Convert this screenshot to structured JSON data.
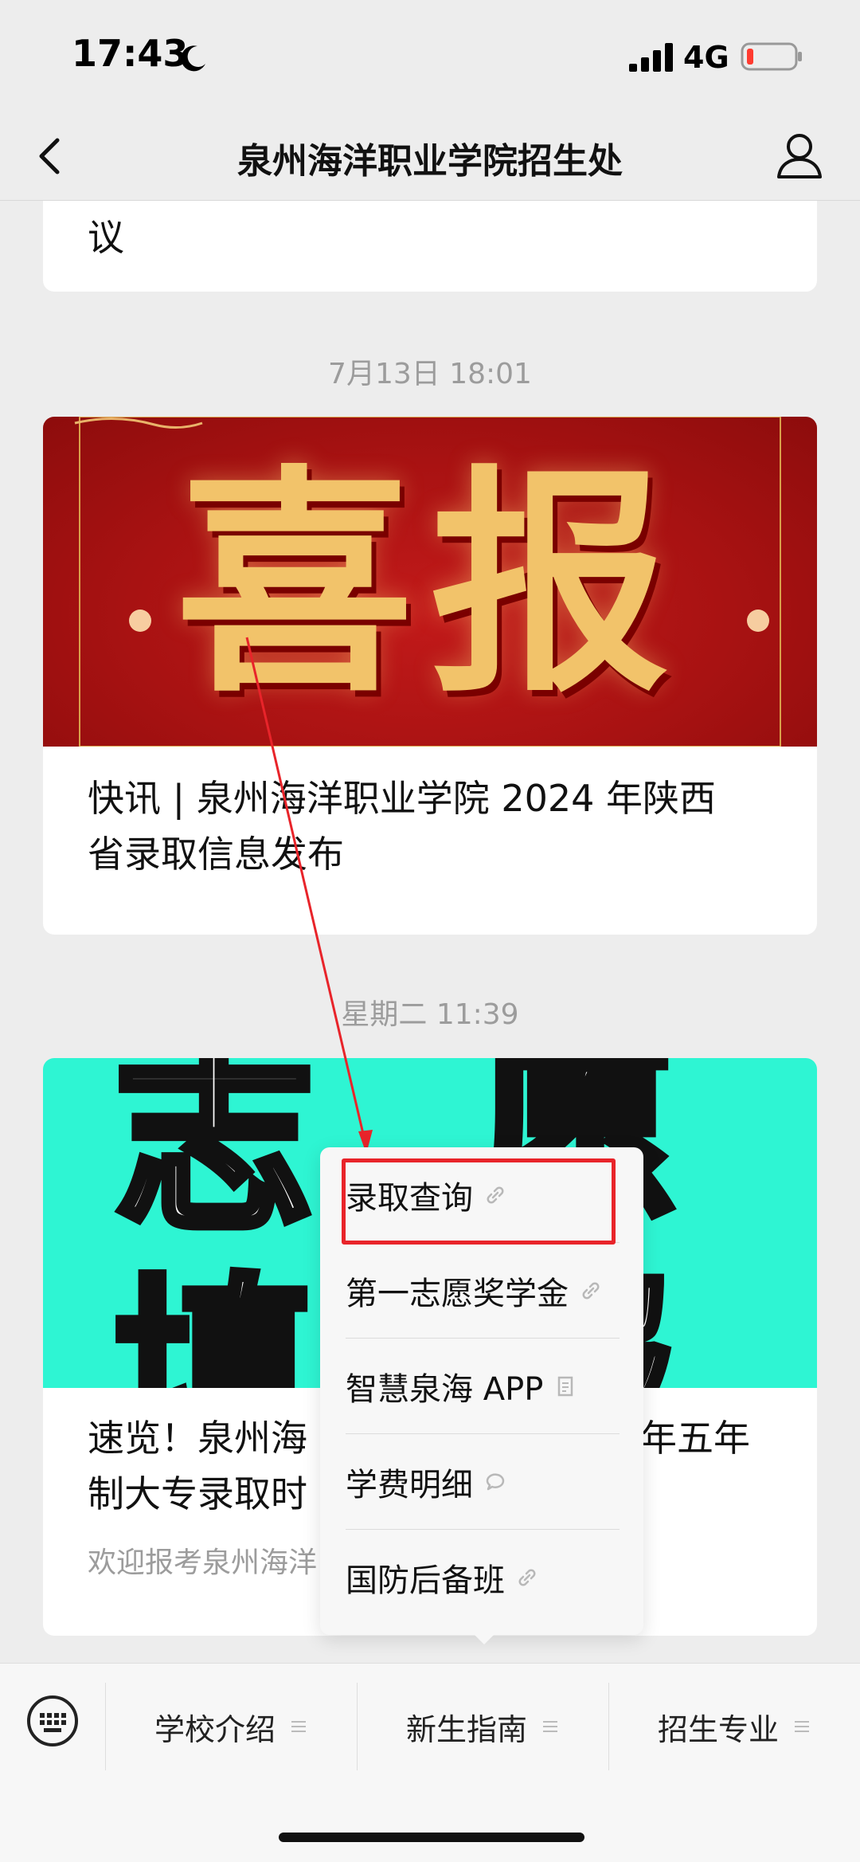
{
  "status": {
    "time": "17:43",
    "network": "4G"
  },
  "nav": {
    "title": "泉州海洋职业学院招生处"
  },
  "feed": {
    "partial_card_text": "议",
    "ts1": "7月13日 18:01",
    "card1": {
      "banner_text": "喜报",
      "title_line1": "快讯 | 泉州海洋职业学院 2024 年陕西",
      "title_line2": "省录取信息发布"
    },
    "ts2": "星期二 11:39",
    "card2": {
      "banner_text_top": "志 愿",
      "banner_text_bottom": "填 报",
      "title_line1_left": "速览！泉州海",
      "title_line1_right": "年五年",
      "title_line2": "制大专录取时",
      "subtitle": "欢迎报考泉州海洋"
    }
  },
  "popup_menu": {
    "items": [
      {
        "label": "录取查询",
        "icon": "link-icon"
      },
      {
        "label": "第一志愿奖学金",
        "icon": "link-icon"
      },
      {
        "label": "智慧泉海 APP",
        "icon": "document-icon"
      },
      {
        "label": "学费明细",
        "icon": "chat-bubble-icon"
      },
      {
        "label": "国防后备班",
        "icon": "link-icon"
      }
    ],
    "highlight_color": "#e8242a"
  },
  "bottom_menu": {
    "items": [
      {
        "label": "学校介绍"
      },
      {
        "label": "新生指南"
      },
      {
        "label": "招生专业"
      }
    ]
  }
}
